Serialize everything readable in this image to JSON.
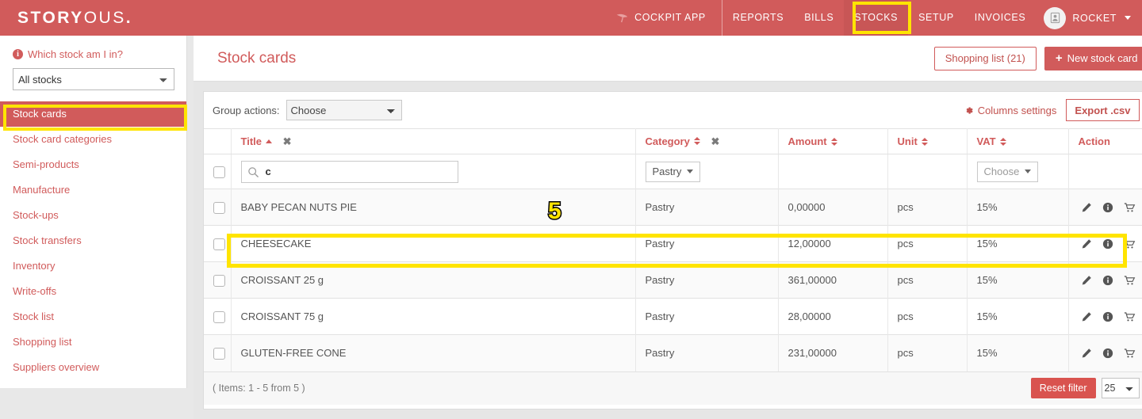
{
  "brand": {
    "bold": "STORY",
    "light": "OUS",
    "dot": "."
  },
  "topnav": {
    "cockpit_label": "COCKPIT APP",
    "items": [
      {
        "label": "REPORTS",
        "active": false
      },
      {
        "label": "BILLS",
        "active": false
      },
      {
        "label": "STOCKS",
        "active": true
      },
      {
        "label": "SETUP",
        "active": false
      },
      {
        "label": "INVOICES",
        "active": false
      }
    ],
    "user": "ROCKET"
  },
  "sidebar": {
    "question": "Which stock am I in?",
    "stock_select_value": "All stocks",
    "items": [
      {
        "label": "Stock cards",
        "active": true
      },
      {
        "label": "Stock card categories",
        "active": false
      },
      {
        "label": "Semi-products",
        "active": false
      },
      {
        "label": "Manufacture",
        "active": false
      },
      {
        "label": "Stock-ups",
        "active": false
      },
      {
        "label": "Stock transfers",
        "active": false
      },
      {
        "label": "Inventory",
        "active": false
      },
      {
        "label": "Write-offs",
        "active": false
      },
      {
        "label": "Stock list",
        "active": false
      },
      {
        "label": "Shopping list",
        "active": false
      },
      {
        "label": "Suppliers overview",
        "active": false
      }
    ]
  },
  "header": {
    "title": "Stock cards",
    "shopping_list_label": "Shopping list (21)",
    "new_stock_card_label": "New stock card",
    "new_stock_card_plus": "+"
  },
  "toolbar": {
    "group_actions_label": "Group actions:",
    "group_actions_value": "Choose",
    "columns_settings_label": "Columns settings",
    "export_label": "Export .csv"
  },
  "table": {
    "headers": {
      "title": "Title",
      "category": "Category",
      "amount": "Amount",
      "unit": "Unit",
      "vat": "VAT",
      "action": "Action"
    },
    "header_clear_icon": "✖",
    "filters": {
      "title_search_value": "c",
      "title_search_placeholder": "",
      "category_value": "Pastry",
      "vat_value": "Choose"
    },
    "rows": [
      {
        "title": "BABY PECAN NUTS PIE",
        "category": "Pastry",
        "amount": "0,00000",
        "unit": "pcs",
        "vat": "15%"
      },
      {
        "title": "CHEESECAKE",
        "category": "Pastry",
        "amount": "12,00000",
        "unit": "pcs",
        "vat": "15%"
      },
      {
        "title": "CROISSANT 25 g",
        "category": "Pastry",
        "amount": "361,00000",
        "unit": "pcs",
        "vat": "15%"
      },
      {
        "title": "CROISSANT 75 g",
        "category": "Pastry",
        "amount": "28,00000",
        "unit": "pcs",
        "vat": "15%"
      },
      {
        "title": "GLUTEN-FREE CONE",
        "category": "Pastry",
        "amount": "231,00000",
        "unit": "pcs",
        "vat": "15%"
      }
    ]
  },
  "footer": {
    "items_count": "( Items: 1 - 5 from 5 )",
    "reset_filter_label": "Reset filter",
    "per_page_value": "25"
  },
  "annotations": {
    "step_number": "5"
  },
  "colors": {
    "brand_red": "#d15b5b",
    "link_red": "#c2524f",
    "highlight_yellow": "#ffe400",
    "reset_red": "#d9534f"
  }
}
